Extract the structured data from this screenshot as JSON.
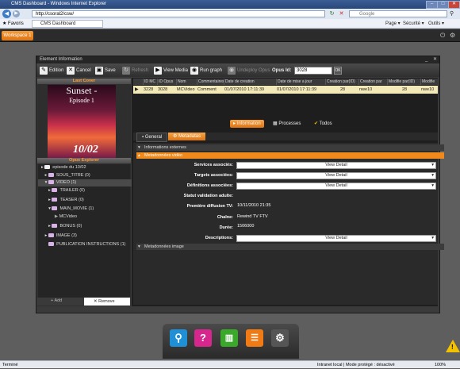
{
  "browser": {
    "title": "CMS Dashboard - Windows Internet Explorer",
    "url": "http://csoral2/csw/",
    "search_placeholder": "Google",
    "favorites_label": "Favoris",
    "tab_label": "CMS Dashboard",
    "menu_page": "Page ▾",
    "menu_security": "Sécurité ▾",
    "menu_tools": "Outils ▾",
    "status_left": "Terminé",
    "status_zone": "Intranet local | Mode protégé : désactivé",
    "zoom": "100%"
  },
  "workspace": {
    "tab_label": "Workspace 1"
  },
  "window": {
    "title": "Element Information",
    "toolbar": {
      "edition": "Edition",
      "cancel": "Cancel",
      "save": "Save",
      "refresh": "Refresh",
      "view_media": "View Media",
      "run_graph": "Run graph",
      "undeploy": "Undeploy Opus",
      "opus_id_label": "Opus Id:",
      "opus_id_value": "3028",
      "ok": "OK"
    }
  },
  "left_panel": {
    "cover_header": "Last Cover",
    "cover_title": "Sunset -",
    "cover_subtitle": "Episode 1",
    "cover_number": "10/02",
    "explorer_header": "Opus Explorer",
    "tree": [
      {
        "label": "episode du 10/02",
        "depth": 0
      },
      {
        "label": "SOUS_TITRE (0)",
        "depth": 1
      },
      {
        "label": "VIDEO (1)",
        "depth": 1
      },
      {
        "label": "TRAILER (0)",
        "depth": 2
      },
      {
        "label": "TEASER (0)",
        "depth": 2
      },
      {
        "label": "MAIN_MOVIE (1)",
        "depth": 2
      },
      {
        "label": "MCVideo",
        "depth": 3
      },
      {
        "label": "BONUS (0)",
        "depth": 2
      },
      {
        "label": "IMAGE (3)",
        "depth": 1
      },
      {
        "label": "PUBLICATION INSTRUCTIONS (1)",
        "depth": 1
      }
    ],
    "footer_add": "Add",
    "footer_remove": "Remove"
  },
  "table": {
    "columns": [
      "ID MC",
      "ID Opus",
      "Nom",
      "Commentaires",
      "Date de creation",
      "Date de mise a jour",
      "Creation par(ID)",
      "Creation par",
      "Modifie par(ID)",
      "Modifie"
    ],
    "row": [
      "3228",
      "3028",
      "MCVideo",
      "Comment",
      "01/07/2010 17:11:39",
      "01/07/2010 17:11:39",
      "28",
      "nwe10",
      "28",
      "nwe10"
    ]
  },
  "tabs": {
    "information": "Information",
    "processes": "Processes",
    "todos": "Todos"
  },
  "subtabs": {
    "general": "General",
    "metadatas": "Metadatas"
  },
  "form": {
    "section_external": "Informations externes",
    "section_video": "Metadonnées vidéo",
    "section_image": "Metadonnées image",
    "services_label": "Services associés:",
    "targets_label": "Targets associées:",
    "definitions_label": "Définitions associées:",
    "validation_label": "Statut validation adulte:",
    "broadcast_label": "Première diffusion TV:",
    "broadcast_value": "10/11/2010 21:35",
    "channel_label": "Chaîne:",
    "channel_value": "Rewind TV FTV",
    "duration_label": "Durée:",
    "duration_value": "1506000",
    "descriptions_label": "Descriptions:",
    "view_detail": "View Detail"
  },
  "colors": {
    "accent_orange": "#f08a1c",
    "row_highlight": "#f3e9b8",
    "dock_search": "#1f8fd6",
    "dock_help": "#d7278f",
    "dock_chart": "#3aa82a",
    "dock_list": "#f07a14"
  }
}
